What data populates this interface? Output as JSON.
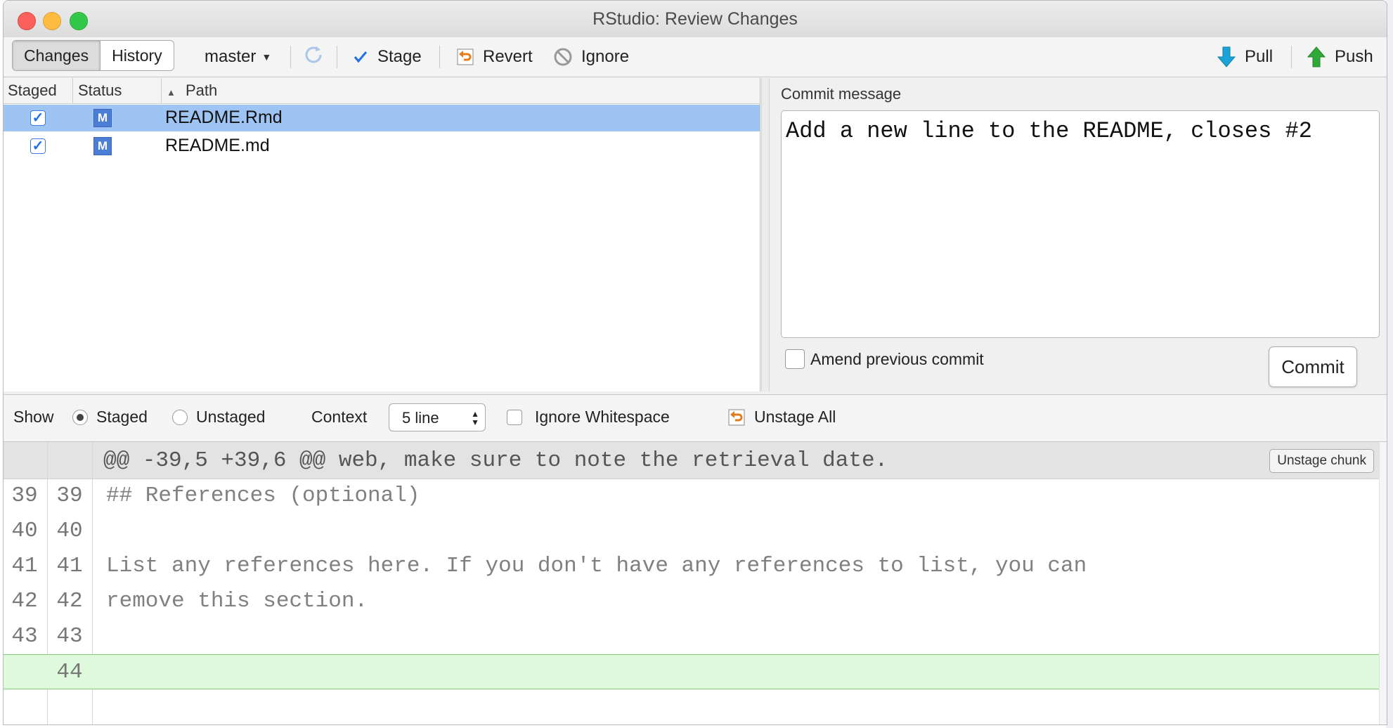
{
  "window": {
    "title": "RStudio: Review Changes"
  },
  "toolbar": {
    "tabs": [
      {
        "label": "Changes"
      },
      {
        "label": "History"
      }
    ],
    "branch": "master",
    "stage_label": "Stage",
    "revert_label": "Revert",
    "ignore_label": "Ignore",
    "pull_label": "Pull",
    "push_label": "Push"
  },
  "files": {
    "columns": {
      "staged": "Staged",
      "status": "Status",
      "path": "Path"
    },
    "rows": [
      {
        "staged": true,
        "status": "M",
        "path": "README.Rmd",
        "selected": true
      },
      {
        "staged": true,
        "status": "M",
        "path": "README.md",
        "selected": false
      }
    ]
  },
  "commit": {
    "label": "Commit message",
    "message": "Add a new line to the README, closes #2",
    "amend_label": "Amend previous commit",
    "button_label": "Commit"
  },
  "options": {
    "show_label": "Show",
    "staged_label": "Staged",
    "unstaged_label": "Unstaged",
    "context_label": "Context",
    "context_value": "5 line",
    "ignore_ws_label": "Ignore Whitespace",
    "unstage_all_label": "Unstage All"
  },
  "diff": {
    "hunk_header": "@@ -39,5 +39,6 @@ web, make sure to note the retrieval date.",
    "unstage_chunk_label": "Unstage chunk",
    "lines": [
      {
        "old": "39",
        "new": "39",
        "text": "## References (optional)"
      },
      {
        "old": "40",
        "new": "40",
        "text": ""
      },
      {
        "old": "41",
        "new": "41",
        "text": "List any references here. If you don't have any references to list, you can"
      },
      {
        "old": "42",
        "new": "42",
        "text": "remove this section."
      },
      {
        "old": "43",
        "new": "43",
        "text": ""
      },
      {
        "old": "",
        "new": "44",
        "text": ""
      }
    ]
  },
  "colors": {
    "accent": "#1f6fe6",
    "selection": "#9ec4f3",
    "added_line": "#dff9dc",
    "pull_arrow": "#1aa3d6",
    "push_arrow": "#2ea836"
  },
  "icons": [
    "refresh-icon",
    "revert-icon",
    "ignore-icon",
    "pull-arrow-icon",
    "push-arrow-icon",
    "unstage-all-icon"
  ]
}
